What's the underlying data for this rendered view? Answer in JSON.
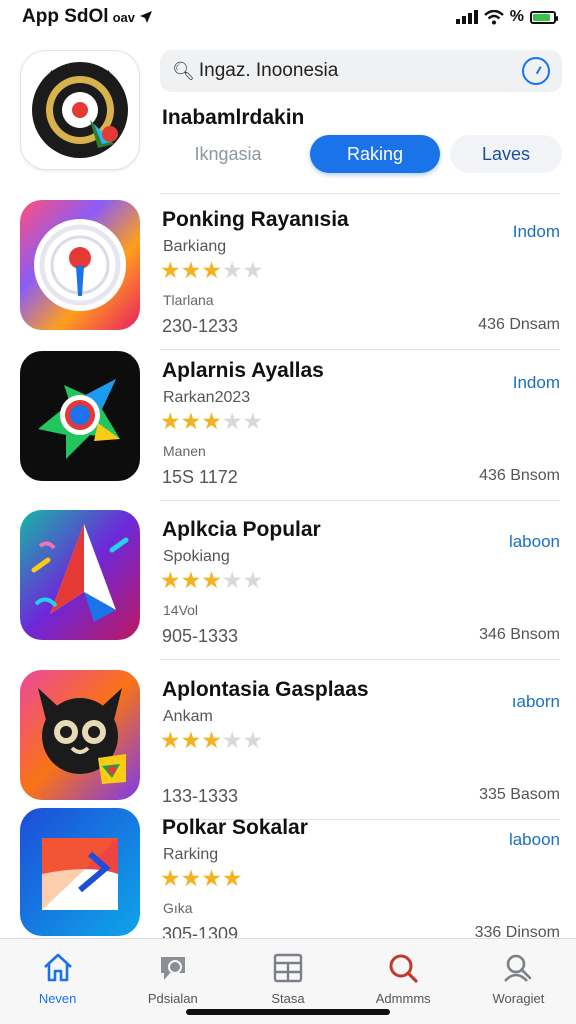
{
  "status_bar": {
    "time": "App SdOl",
    "carrier": "oav",
    "battery": "%"
  },
  "header": {
    "app_icon": "target-logo-icon",
    "search_value": "Ingaz. Inoonesia",
    "section_title": "Inabamlrdakin",
    "segments": [
      "Ikngasia",
      "Raking",
      "Laves"
    ]
  },
  "apps": [
    {
      "name": "Ponking Rayanısia",
      "subtitle": "Barkiang",
      "stars_text": "★★★",
      "stars_off": "★★",
      "meta": "Tlarlana",
      "range": "230-1233",
      "action": "Indom",
      "size": "436 Dnsam"
    },
    {
      "name": "Aplarnis Ayallas",
      "subtitle": "Rarkan2023",
      "stars_text": "★★★",
      "stars_off": "★★",
      "meta": "Manen",
      "range": "15S 1172",
      "action": "Indom",
      "size": "436 Bnsom"
    },
    {
      "name": "Aplkcia Popular",
      "subtitle": "Spokiang",
      "stars_text": "★★★",
      "stars_off": "★★",
      "meta": "14Vol",
      "range": "905-1333",
      "action": "laboon",
      "size": "346 Bnsom"
    },
    {
      "name": "Aplontasia Gasplaas",
      "subtitle": "Ankam",
      "stars_text": "★★★",
      "stars_off": "★★",
      "meta": "",
      "range": "133-1333",
      "action": "ıaborn",
      "size": "335 Basom"
    },
    {
      "name": "Polkar Sokalar",
      "subtitle": "Rarking",
      "stars_text": "★★★★",
      "stars_off": "",
      "meta": "Gıka",
      "range": "305-1309",
      "action": "laboon",
      "size": "336 Dinsom"
    }
  ],
  "tabs": [
    {
      "label": "Neven",
      "icon": "home-icon"
    },
    {
      "label": "Pdsialan",
      "icon": "chat-icon"
    },
    {
      "label": "Stasa",
      "icon": "grid-icon"
    },
    {
      "label": "Admmms",
      "icon": "search-icon"
    },
    {
      "label": "Woragiet",
      "icon": "profile-search-icon"
    }
  ],
  "colors": {
    "accent": "#1a73e8",
    "star": "#f3b220",
    "action_link": "#1a6fc4"
  }
}
